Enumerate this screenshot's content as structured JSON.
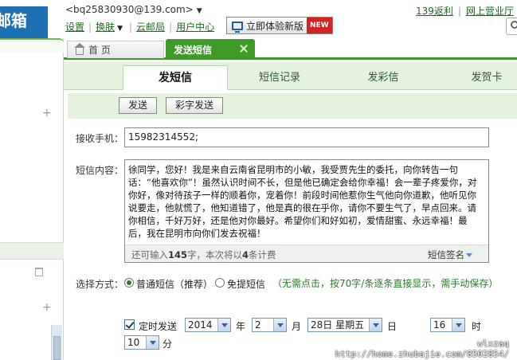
{
  "header": {
    "logo_text": "邮箱",
    "account": "<bq25830930@139.com>",
    "nav": [
      "设置",
      "换肤",
      "云邮局",
      "用户中心"
    ],
    "new_version_label": "立即体验新版",
    "new_tag": "NEW",
    "top_links": [
      "139返利",
      "网上营业厅"
    ]
  },
  "tabs": {
    "home": "首 页",
    "sms": "发送短信"
  },
  "subtabs": [
    "发短信",
    "短信记录",
    "发彩信",
    "发贺卡"
  ],
  "toolbar": {
    "send": "发送",
    "mms_send": "彩字发送"
  },
  "form": {
    "recipient_label": "接收手机：",
    "recipient_value": "15982314552;",
    "content_label": "短信内容：",
    "content": "徐同学，您好！我是来自云南省昆明市的小敏，我受贾先生的委托，向你转告一句话：“他喜欢你”！虽然认识时间不长，但是他已确定会给你幸福！会一辈子疼爱你，对你好，像对待孩子一样的顺着你，宠着你！前段时间他惹你生气他向你道歉，他听见你说要走，他就慌了，他知道错了，他是真的很在乎你，请你不要生气了，早点回来。请你相信，千好万好，还是他对你最好。希望你们和好如初，爱情甜蜜、永远幸福！最后，我在昆明市向你们发去祝福！",
    "counter_prefix": "还可输入",
    "counter_remaining": "145",
    "counter_mid": "字，本次将以",
    "counter_count": "4",
    "counter_suffix": "条计费",
    "signature": "短信签名",
    "select_mode_label": "选择方式：",
    "mode_normal": "普通短信（推荐）",
    "mode_free": "免提短信",
    "mode_free_hint": "（无需点击，按70字/条逐条直接显示，需手动保存）",
    "scheduled_label": "定时发送",
    "year": "2014",
    "year_unit": "年",
    "month": "2",
    "month_unit": "月",
    "day": "28日 星期五",
    "day_unit": "日",
    "hour": "16",
    "hour_unit": "时",
    "minute": "10",
    "minute_unit": "分"
  },
  "watermark": {
    "user": "wlxzaq",
    "url": "http://home.zhubajie.com/8502854/"
  }
}
